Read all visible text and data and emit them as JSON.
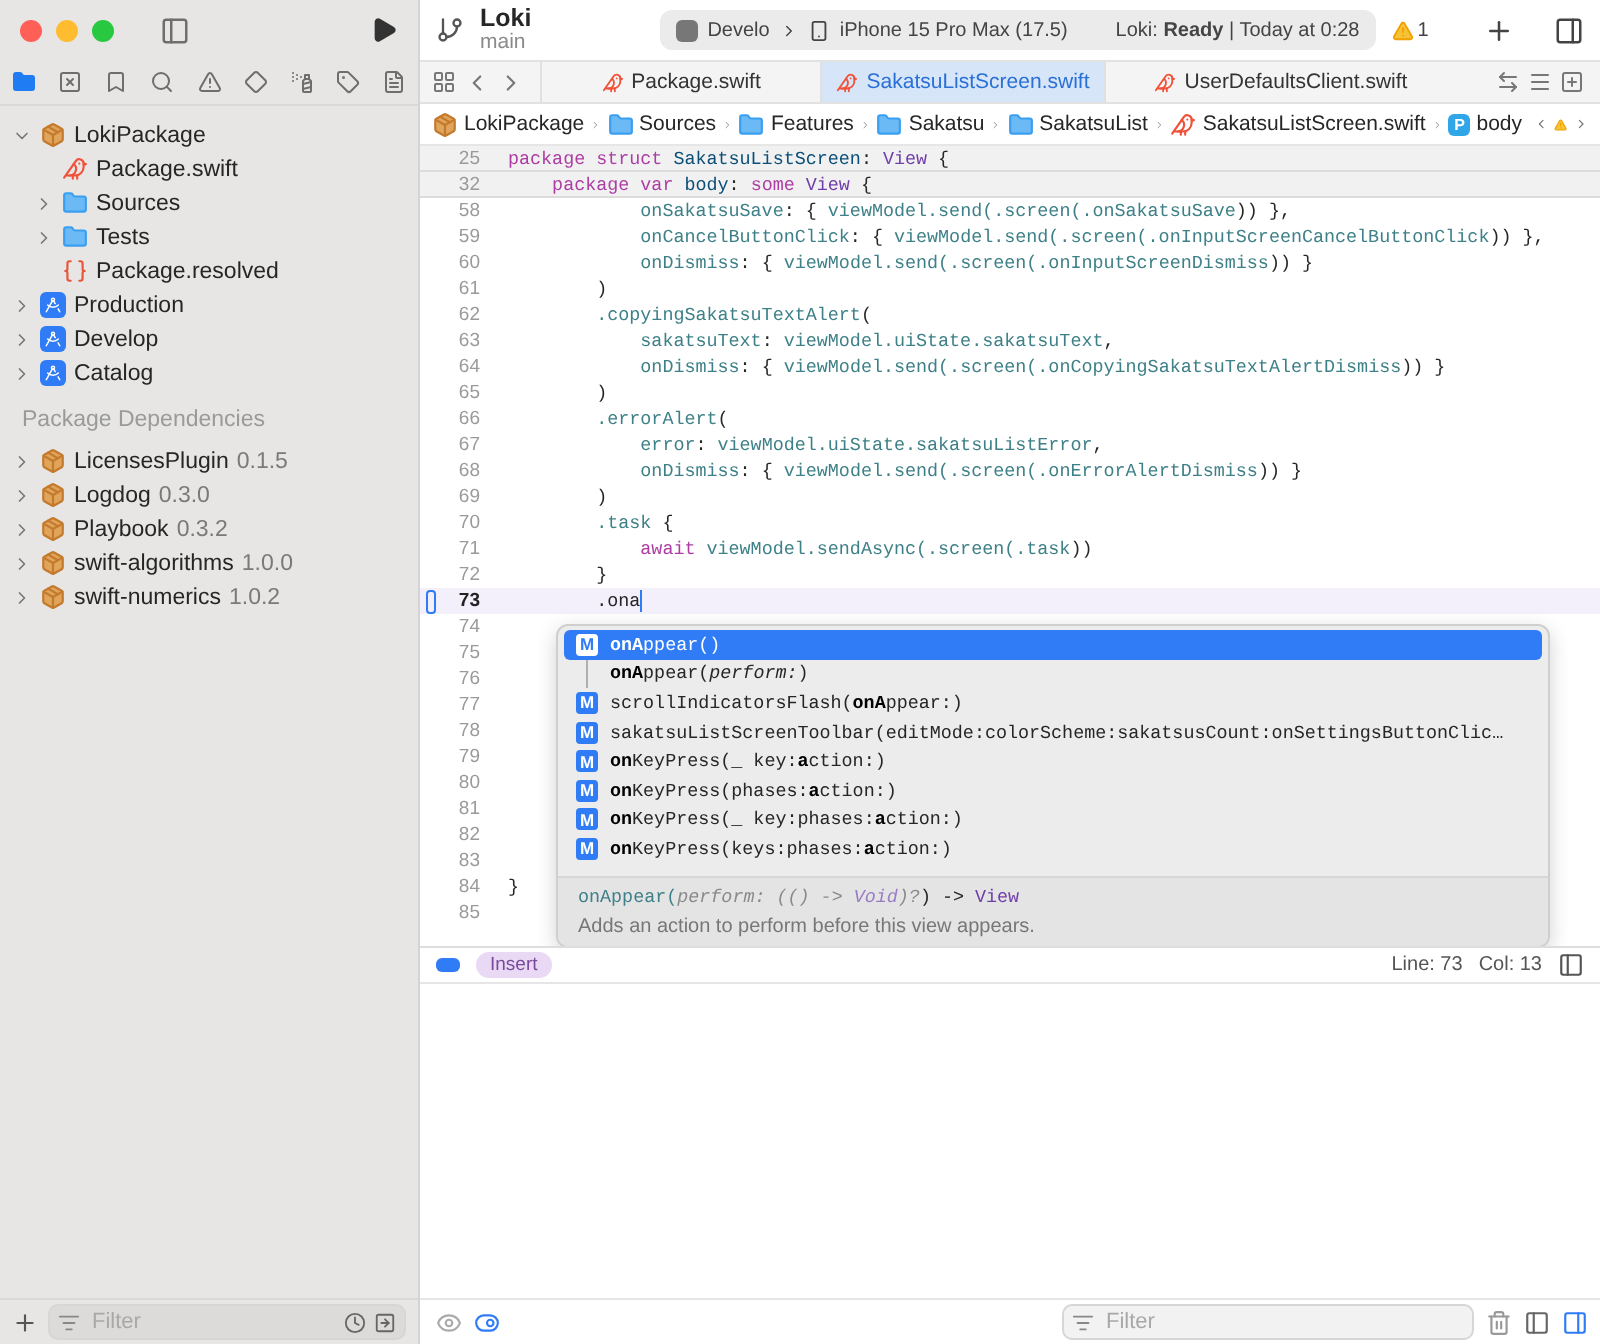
{
  "window": {
    "title": "Loki",
    "branch": "main"
  },
  "toolbar": {
    "scheme": "Develo",
    "destination": "iPhone 15 Pro Max (17.5)",
    "status": "Loki: **Ready** | Today at 0:28",
    "warnings": "1"
  },
  "navigator_tabs": [
    {
      "kind": "project",
      "selected": true
    },
    {
      "kind": "source-control",
      "selected": false
    },
    {
      "kind": "bookmarks",
      "selected": false
    },
    {
      "kind": "find",
      "selected": false
    },
    {
      "kind": "issues",
      "selected": false
    },
    {
      "kind": "tests",
      "selected": false
    },
    {
      "kind": "debug",
      "selected": false
    },
    {
      "kind": "breakpoints",
      "selected": false
    },
    {
      "kind": "reports",
      "selected": false
    }
  ],
  "project_tree": [
    {
      "name": "LokiPackage",
      "kind": "package",
      "expanded": true,
      "children": [
        {
          "name": "Package.swift",
          "kind": "swift"
        },
        {
          "name": "Sources",
          "kind": "folder",
          "expanded": false
        },
        {
          "name": "Tests",
          "kind": "folder",
          "expanded": false
        },
        {
          "name": "Package.resolved",
          "kind": "resolved"
        }
      ]
    },
    {
      "name": "Production",
      "kind": "project",
      "expanded": false
    },
    {
      "name": "Develop",
      "kind": "project",
      "expanded": false
    },
    {
      "name": "Catalog",
      "kind": "project",
      "expanded": false
    }
  ],
  "dependencies": {
    "title": "Package Dependencies",
    "items": [
      {
        "name": "LicensesPlugin",
        "version": "0.1.5",
        "expanded": false
      },
      {
        "name": "Logdog",
        "version": "0.3.0",
        "expanded": false
      },
      {
        "name": "Playbook",
        "version": "0.3.2",
        "expanded": false
      },
      {
        "name": "swift-algorithms",
        "version": "1.0.0",
        "expanded": false
      },
      {
        "name": "swift-numerics",
        "version": "1.0.2",
        "expanded": false
      }
    ]
  },
  "sidebar_filter": {
    "placeholder": "Filter"
  },
  "editor_tabs": [
    {
      "label": "Package.swift",
      "selected": false
    },
    {
      "label": "SakatsuListScreen.swift",
      "selected": true
    },
    {
      "label": "UserDefaultsClient.swift",
      "selected": false
    }
  ],
  "breadcrumb": [
    {
      "label": "LokiPackage",
      "kind": "package"
    },
    {
      "label": "Sources",
      "kind": "folder"
    },
    {
      "label": "Features",
      "kind": "folder"
    },
    {
      "label": "Sakatsu",
      "kind": "folder"
    },
    {
      "label": "SakatsuList",
      "kind": "folder"
    },
    {
      "label": "SakatsuListScreen.swift",
      "kind": "swift"
    },
    {
      "label": "body",
      "kind": "symbol",
      "symbol": "P"
    }
  ],
  "code": {
    "sticky": [
      {
        "number": "25",
        "segments": [
          {
            "text": "package struct ",
            "kind": "keyword"
          },
          {
            "text": "SakatsuListScreen",
            "kind": "decl"
          },
          {
            "text": ": ",
            "kind": "plain"
          },
          {
            "text": "View",
            "kind": "type"
          },
          {
            "text": " {",
            "kind": "plain"
          }
        ]
      },
      {
        "number": "32",
        "segments": [
          {
            "text": "    package var ",
            "kind": "keyword"
          },
          {
            "text": "body",
            "kind": "decl"
          },
          {
            "text": ": ",
            "kind": "plain"
          },
          {
            "text": "some ",
            "kind": "keyword"
          },
          {
            "text": "View",
            "kind": "type"
          },
          {
            "text": " {",
            "kind": "plain"
          }
        ]
      }
    ],
    "lines": [
      {
        "number": "58",
        "current": false,
        "segments": [
          {
            "text": "            onSakatsuSave",
            "kind": "member"
          },
          {
            "text": ": { ",
            "kind": "plain"
          },
          {
            "text": "viewModel.send(.screen(.onSakatsuSave",
            "kind": "member"
          },
          {
            "text": ")) },",
            "kind": "plain"
          }
        ]
      },
      {
        "number": "59",
        "current": false,
        "segments": [
          {
            "text": "            onCancelButtonClick",
            "kind": "member"
          },
          {
            "text": ": { ",
            "kind": "plain"
          },
          {
            "text": "viewModel.send(.screen(.onInputScreenCancelButtonClick",
            "kind": "member"
          },
          {
            "text": ")) },",
            "kind": "plain"
          }
        ]
      },
      {
        "number": "60",
        "current": false,
        "segments": [
          {
            "text": "            onDismiss",
            "kind": "member"
          },
          {
            "text": ": { ",
            "kind": "plain"
          },
          {
            "text": "viewModel.send(.screen(.onInputScreenDismiss",
            "kind": "member"
          },
          {
            "text": ")) }",
            "kind": "plain"
          }
        ]
      },
      {
        "number": "61",
        "current": false,
        "segments": [
          {
            "text": "        )",
            "kind": "plain"
          }
        ]
      },
      {
        "number": "62",
        "current": false,
        "segments": [
          {
            "text": "        .copyingSakatsuTextAlert",
            "kind": "member"
          },
          {
            "text": "(",
            "kind": "plain"
          }
        ]
      },
      {
        "number": "63",
        "current": false,
        "segments": [
          {
            "text": "            sakatsuText",
            "kind": "member"
          },
          {
            "text": ": ",
            "kind": "plain"
          },
          {
            "text": "viewModel.uiState.sakatsuText",
            "kind": "member"
          },
          {
            "text": ",",
            "kind": "plain"
          }
        ]
      },
      {
        "number": "64",
        "current": false,
        "segments": [
          {
            "text": "            onDismiss",
            "kind": "member"
          },
          {
            "text": ": { ",
            "kind": "plain"
          },
          {
            "text": "viewModel.send(.screen(.onCopyingSakatsuTextAlertDismiss",
            "kind": "member"
          },
          {
            "text": ")) }",
            "kind": "plain"
          }
        ]
      },
      {
        "number": "65",
        "current": false,
        "segments": [
          {
            "text": "        )",
            "kind": "plain"
          }
        ]
      },
      {
        "number": "66",
        "current": false,
        "segments": [
          {
            "text": "        .errorAlert",
            "kind": "member"
          },
          {
            "text": "(",
            "kind": "plain"
          }
        ]
      },
      {
        "number": "67",
        "current": false,
        "segments": [
          {
            "text": "            error",
            "kind": "member"
          },
          {
            "text": ": ",
            "kind": "plain"
          },
          {
            "text": "viewModel.uiState.sakatsuListError",
            "kind": "member"
          },
          {
            "text": ",",
            "kind": "plain"
          }
        ]
      },
      {
        "number": "68",
        "current": false,
        "segments": [
          {
            "text": "            onDismiss",
            "kind": "member"
          },
          {
            "text": ": { ",
            "kind": "plain"
          },
          {
            "text": "viewModel.send(.screen(.onErrorAlertDismiss",
            "kind": "member"
          },
          {
            "text": ")) }",
            "kind": "plain"
          }
        ]
      },
      {
        "number": "69",
        "current": false,
        "segments": [
          {
            "text": "        )",
            "kind": "plain"
          }
        ]
      },
      {
        "number": "70",
        "current": false,
        "segments": [
          {
            "text": "        .task",
            "kind": "member"
          },
          {
            "text": " {",
            "kind": "plain"
          }
        ]
      },
      {
        "number": "71",
        "current": false,
        "segments": [
          {
            "text": "            await ",
            "kind": "keyword"
          },
          {
            "text": "viewModel.sendAsync(.screen(.task",
            "kind": "member"
          },
          {
            "text": "))",
            "kind": "plain"
          }
        ]
      },
      {
        "number": "72",
        "current": false,
        "segments": [
          {
            "text": "        }",
            "kind": "plain"
          }
        ]
      },
      {
        "number": "73",
        "current": true,
        "segments": [
          {
            "text": "        .ona",
            "kind": "plain"
          }
        ]
      },
      {
        "number": "74",
        "current": false
      },
      {
        "number": "75",
        "current": false
      },
      {
        "number": "76",
        "current": false
      },
      {
        "number": "77",
        "current": false
      },
      {
        "number": "78",
        "current": false
      },
      {
        "number": "79",
        "current": false
      },
      {
        "number": "80",
        "current": false
      },
      {
        "number": "81",
        "current": false
      },
      {
        "number": "82",
        "current": false
      },
      {
        "number": "83",
        "current": false
      },
      {
        "number": "84",
        "current": false,
        "segments": [
          {
            "text": "}",
            "kind": "plain"
          }
        ]
      },
      {
        "number": "85",
        "current": false
      }
    ]
  },
  "completion": {
    "items": [
      {
        "kind": "method",
        "symbol": "M",
        "text": "**onA**ppear()",
        "selected": true
      },
      {
        "kind": "overload",
        "text": "**onA**ppear(*perform:*)",
        "selected": false
      },
      {
        "kind": "method",
        "symbol": "M",
        "text": "scrollIndicatorsFlash(**onA**ppear:)",
        "selected": false
      },
      {
        "kind": "method",
        "symbol": "M",
        "text": "sakatsuListScreenToolbar(editMode:colorScheme:sakatsusCount:onSettingsButtonClic…",
        "selected": false
      },
      {
        "kind": "method",
        "symbol": "M",
        "text": "**on**KeyPress(_ key:**a**ction:)",
        "selected": false
      },
      {
        "kind": "method",
        "symbol": "M",
        "text": "**on**KeyPress(phases:**a**ction:)",
        "selected": false
      },
      {
        "kind": "method",
        "symbol": "M",
        "text": "**on**KeyPress(_ key:phases:**a**ction:)",
        "selected": false
      },
      {
        "kind": "method",
        "symbol": "M",
        "text": "**on**KeyPress(keys:phases:**a**ction:)",
        "selected": false
      }
    ],
    "signature": [
      {
        "text": "onAppear(",
        "kind": "member"
      },
      {
        "text": "perform: (() -> ",
        "kind": "param"
      },
      {
        "text": "Void",
        "kind": "ptype"
      },
      {
        "text": ")?",
        "kind": "param"
      },
      {
        "text": ") -> ",
        "kind": "plain"
      },
      {
        "text": "View",
        "kind": "type"
      }
    ],
    "summary": "Adds an action to perform before this view appears."
  },
  "debug_bar": {
    "mode": "Insert",
    "line": "Line: 73",
    "column": "Col: 13"
  },
  "console_filter": {
    "placeholder": "Filter"
  }
}
